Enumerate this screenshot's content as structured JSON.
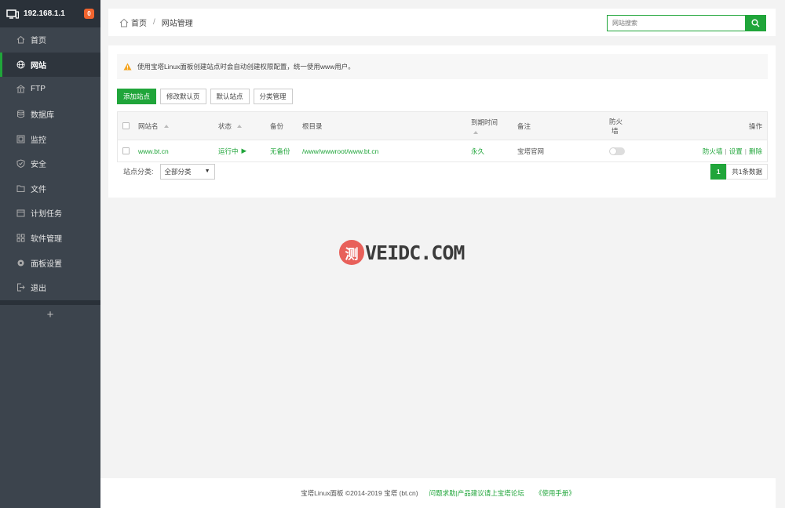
{
  "sidebar": {
    "ip": "192.168.1.1",
    "badge": "0",
    "items": [
      {
        "label": "首页",
        "icon": "home-icon"
      },
      {
        "label": "网站",
        "icon": "globe-icon"
      },
      {
        "label": "FTP",
        "icon": "ftp-icon"
      },
      {
        "label": "数据库",
        "icon": "database-icon"
      },
      {
        "label": "监控",
        "icon": "monitor-icon"
      },
      {
        "label": "安全",
        "icon": "shield-icon"
      },
      {
        "label": "文件",
        "icon": "folder-icon"
      },
      {
        "label": "计划任务",
        "icon": "calendar-icon"
      },
      {
        "label": "软件管理",
        "icon": "apps-icon"
      },
      {
        "label": "面板设置",
        "icon": "settings-icon"
      },
      {
        "label": "退出",
        "icon": "logout-icon"
      }
    ],
    "add": "+"
  },
  "breadcrumb": {
    "home": "首页",
    "sep": "/",
    "current": "网站管理"
  },
  "search": {
    "placeholder": "网站搜索"
  },
  "notice": "使用宝塔Linux面板创建站点时会自动创建权限配置，统一使用www用户。",
  "buttons": {
    "add": "添加站点",
    "modify_default": "修改默认页",
    "default_site": "默认站点",
    "category": "分类管理"
  },
  "table": {
    "headers": {
      "name": "网站名",
      "status": "状态",
      "backup": "备份",
      "root": "根目录",
      "expire": "到期时间",
      "note": "备注",
      "firewall_1": "防火",
      "firewall_2": "墙",
      "actions": "操作"
    },
    "rows": [
      {
        "name": "www.bt.cn",
        "status": "运行中",
        "status_icon": "▶",
        "backup": "无备份",
        "root": "/www/wwwroot/www.bt.cn",
        "expire": "永久",
        "note": "宝塔官网",
        "firewall": false,
        "act_firewall": "防火墙",
        "act_sep": "|",
        "act_settings": "设置",
        "act_delete": "删除"
      }
    ]
  },
  "category": {
    "label": "站点分类:",
    "selected": "全部分类"
  },
  "pager": {
    "page": "1",
    "total": "共1条数据"
  },
  "watermark": {
    "char": "测",
    "text": "VEIDC.COM"
  },
  "footer": {
    "copyright": "宝塔Linux面板 ©2014-2019 宝塔 (bt.cn)",
    "forum": "问题求助|产品建议请上宝塔论坛",
    "manual": "《使用手册》"
  },
  "colors": {
    "accent": "#20a53a",
    "sidebar": "#3c444d",
    "badge": "#f0642e"
  }
}
